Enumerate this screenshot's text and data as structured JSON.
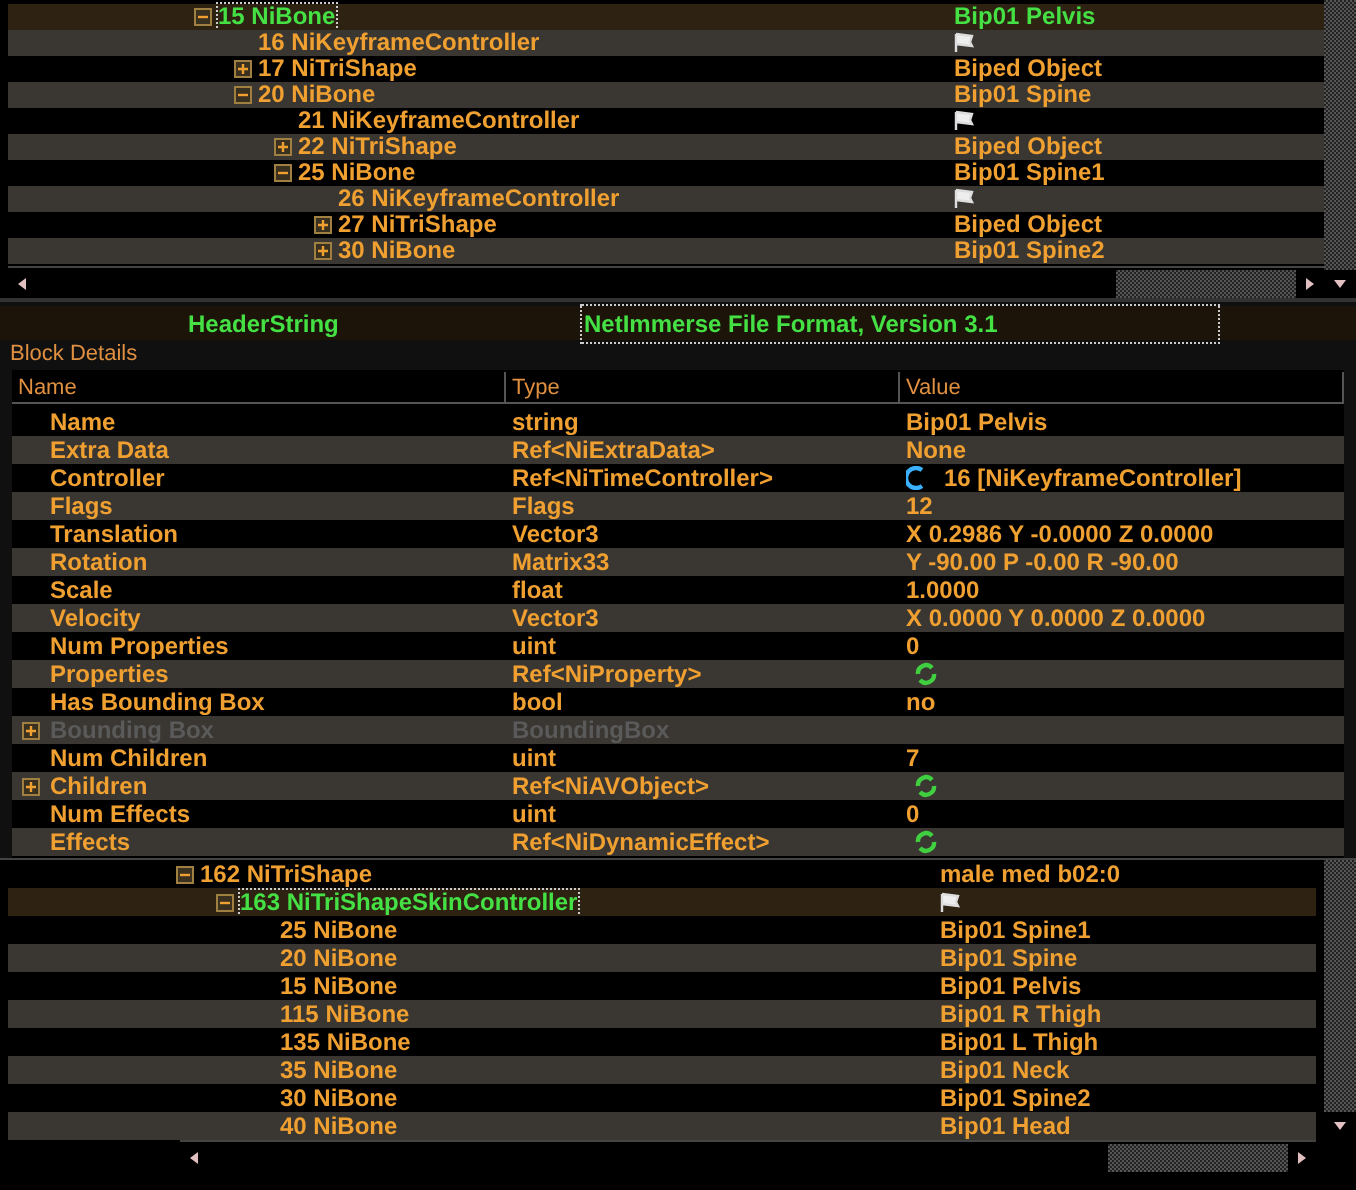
{
  "block_tree": {
    "rows": [
      {
        "kind": "text",
        "label": "15 NiBone",
        "value": "Bip01 Pelvis",
        "selected": true,
        "expanded": true,
        "children": [
          {
            "kind": "flag",
            "label": "16 NiKeyframeController",
            "selected": false
          },
          {
            "kind": "text",
            "label": "17 NiTriShape",
            "value": "Biped Object",
            "selected": false,
            "expanded": false
          },
          {
            "kind": "text",
            "label": "20 NiBone",
            "value": "Bip01 Spine",
            "selected": false,
            "expanded": true,
            "children": [
              {
                "kind": "flag",
                "label": "21 NiKeyframeController",
                "selected": false
              },
              {
                "kind": "text",
                "label": "22 NiTriShape",
                "value": "Biped Object",
                "selected": false,
                "expanded": false
              },
              {
                "kind": "text",
                "label": "25 NiBone",
                "value": "Bip01 Spine1",
                "selected": false,
                "expanded": true,
                "children": [
                  {
                    "kind": "flag",
                    "label": "26 NiKeyframeController",
                    "selected": false
                  },
                  {
                    "kind": "text",
                    "label": "27 NiTriShape",
                    "value": "Biped Object",
                    "selected": false,
                    "expanded": false
                  },
                  {
                    "kind": "text",
                    "label": "30 NiBone",
                    "value": "Bip01 Spine2",
                    "selected": false,
                    "expanded": false
                  }
                ]
              }
            ]
          }
        ]
      }
    ]
  },
  "header": {
    "label": "HeaderString",
    "value": "NetImmerse File Format, Version 3.1"
  },
  "block_details": {
    "title": "Block Details",
    "columns": [
      "Name",
      "Type",
      "Value"
    ],
    "rows": [
      {
        "kind": "text",
        "name": "Name",
        "type": "string",
        "value": "Bip01 Pelvis",
        "disabled": false
      },
      {
        "kind": "text",
        "name": "Extra Data",
        "type": "Ref<NiExtraData>",
        "value": "None",
        "disabled": false
      },
      {
        "kind": "link",
        "name": "Controller",
        "type": "Ref<NiTimeController>",
        "value": "16 [NiKeyframeController]",
        "disabled": false
      },
      {
        "kind": "text",
        "name": "Flags",
        "type": "Flags",
        "value": "12",
        "disabled": false
      },
      {
        "kind": "text",
        "name": "Translation",
        "type": "Vector3",
        "value": "X 0.2986 Y -0.0000 Z 0.0000",
        "disabled": false
      },
      {
        "kind": "text",
        "name": "Rotation",
        "type": "Matrix33",
        "value": "Y -90.00 P -0.00 R -90.00",
        "disabled": false
      },
      {
        "kind": "text",
        "name": "Scale",
        "type": "float",
        "value": "1.0000",
        "disabled": false
      },
      {
        "kind": "text",
        "name": "Velocity",
        "type": "Vector3",
        "value": "X 0.0000 Y 0.0000 Z 0.0000",
        "disabled": false
      },
      {
        "kind": "text",
        "name": "Num Properties",
        "type": "uint",
        "value": "0",
        "disabled": false
      },
      {
        "kind": "cycle",
        "name": "Properties",
        "type": "Ref<NiProperty>",
        "disabled": false
      },
      {
        "kind": "text",
        "name": "Has Bounding Box",
        "type": "bool",
        "value": "no",
        "disabled": false
      },
      {
        "kind": "text",
        "name": "Bounding Box",
        "type": "BoundingBox",
        "expanded": false,
        "disabled": true
      },
      {
        "kind": "text",
        "name": "Num Children",
        "type": "uint",
        "value": "7",
        "disabled": false
      },
      {
        "kind": "cycle",
        "name": "Children",
        "type": "Ref<NiAVObject>",
        "expanded": false,
        "disabled": false
      },
      {
        "kind": "text",
        "name": "Num Effects",
        "type": "uint",
        "value": "0",
        "disabled": false
      },
      {
        "kind": "cycle",
        "name": "Effects",
        "type": "Ref<NiDynamicEffect>",
        "disabled": false
      }
    ]
  },
  "skin_tree": {
    "rows": [
      {
        "kind": "text",
        "label": "162 NiTriShape",
        "value": "male med b02:0",
        "selected": false,
        "expanded": true,
        "children": [
          {
            "kind": "flag",
            "label": "163 NiTriShapeSkinController",
            "selected": true,
            "expanded": true,
            "children": [
              {
                "kind": "text",
                "label": "25 NiBone",
                "value": "Bip01 Spine1",
                "selected": false
              },
              {
                "kind": "text",
                "label": "20 NiBone",
                "value": "Bip01 Spine",
                "selected": false
              },
              {
                "kind": "text",
                "label": "15 NiBone",
                "value": "Bip01 Pelvis",
                "selected": false
              },
              {
                "kind": "text",
                "label": "115 NiBone",
                "value": "Bip01 R Thigh",
                "selected": false
              },
              {
                "kind": "text",
                "label": "135 NiBone",
                "value": "Bip01 L Thigh",
                "selected": false
              },
              {
                "kind": "text",
                "label": "35 NiBone",
                "value": "Bip01 Neck",
                "selected": false
              },
              {
                "kind": "text",
                "label": "30 NiBone",
                "value": "Bip01 Spine2",
                "selected": false
              },
              {
                "kind": "text",
                "label": "40 NiBone",
                "value": "Bip01 Head",
                "selected": false
              }
            ]
          }
        ]
      }
    ]
  }
}
